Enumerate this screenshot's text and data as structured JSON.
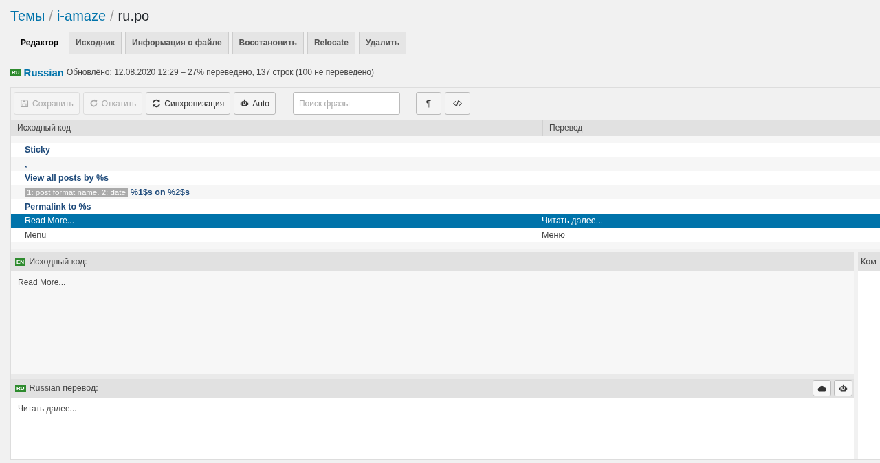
{
  "breadcrumb_separator": "/",
  "breadcrumb": [
    {
      "label": "Темы",
      "link": true
    },
    {
      "label": "i-amaze",
      "link": true
    },
    {
      "label": "ru.po",
      "link": false
    }
  ],
  "tabs": [
    {
      "label": "Редактор",
      "selected": true
    },
    {
      "label": "Исходник",
      "selected": false
    },
    {
      "label": "Информация о файле",
      "selected": false
    },
    {
      "label": "Восстановить",
      "selected": false
    },
    {
      "label": "Relocate",
      "selected": false
    },
    {
      "label": "Удалить",
      "selected": false
    }
  ],
  "status": {
    "badge": "RU",
    "language": "Russian",
    "text": "Обновлёно: 12.08.2020 12:29 – 27% переведено, 137 строк (100 не переведено)"
  },
  "toolbar": {
    "buttons": [
      {
        "kind": "save",
        "label": "Сохранить",
        "disabled": true
      },
      {
        "kind": "revert",
        "label": "Откатить",
        "disabled": true
      },
      {
        "kind": "sync",
        "label": "Синхронизация",
        "disabled": false
      },
      {
        "kind": "auto",
        "label": "Auto",
        "disabled": false
      }
    ],
    "search": {
      "placeholder": "Поиск фразы"
    },
    "toggles": [
      {
        "kind": "pilcrow",
        "glyph": "¶"
      },
      {
        "kind": "code"
      }
    ]
  },
  "table": {
    "columns": [
      "Исходный код",
      "Перевод"
    ],
    "rows": [
      {
        "source": "Sticky",
        "translated": false,
        "selected": false
      },
      {
        "source": ",",
        "translated": false,
        "selected": false
      },
      {
        "source": "View all posts by %s",
        "translated": false,
        "selected": false
      },
      {
        "context": "1: post format name. 2: date",
        "source": "%1$s on %2$s",
        "translated": false,
        "selected": false
      },
      {
        "source": "Permalink to %s",
        "translated": false,
        "selected": false
      },
      {
        "source": "Read More...",
        "translation": "Читать далее...",
        "translated": true,
        "selected": true
      },
      {
        "source": "Menu",
        "translation": "Меню",
        "translated": true,
        "selected": false
      }
    ]
  },
  "source_pane": {
    "badge": "EN",
    "title": "Исходный код:",
    "text": "Read More..."
  },
  "translation_pane": {
    "badge": "RU",
    "title": "Russian перевод:",
    "text": "Читать далее..."
  },
  "comments_pane": {
    "title": "Ком"
  }
}
